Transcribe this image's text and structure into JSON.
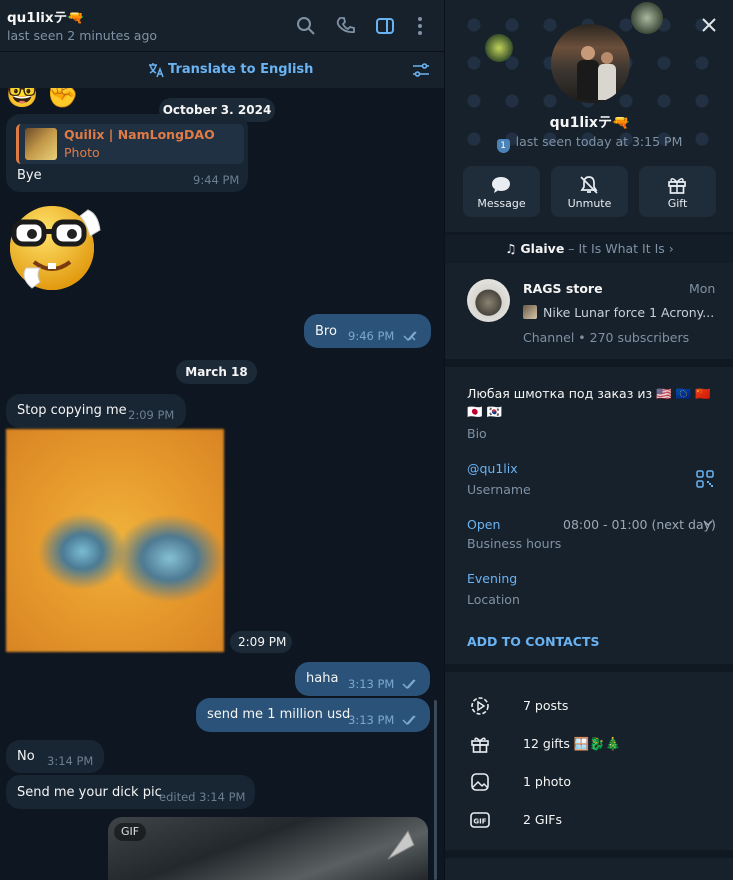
{
  "chat": {
    "header": {
      "title": "qu1lixテ🔫",
      "status": "last seen 2 minutes ago"
    },
    "translate_label": "Translate to English",
    "dates": [
      "October 3, 2024",
      "March 18"
    ],
    "reply": {
      "author": "Quilix | NamLongDAO",
      "kind": "Photo"
    },
    "messages": {
      "bye": {
        "text": "Bye",
        "time": "9:44 PM"
      },
      "bro": {
        "text": "Bro",
        "time": "9:46 PM"
      },
      "stop": {
        "text": "Stop copying me",
        "time": "2:09 PM"
      },
      "photo_time": "2:09 PM",
      "haha": {
        "text": "haha",
        "time": "3:13 PM"
      },
      "million": {
        "text": "send me 1 million usd",
        "time": "3:13 PM"
      },
      "no": {
        "text": "No",
        "time": "3:14 PM"
      },
      "dick": {
        "text": "Send me your dick pic",
        "time": "edited 3:14 PM"
      },
      "gif_label": "GIF"
    },
    "top_emojis": [
      "🤓",
      "✊"
    ]
  },
  "profile": {
    "name": "qu1lixテ🔫",
    "seen": "last seen today at 3:15 PM",
    "badge": "1",
    "actions": [
      "Message",
      "Unmute",
      "Gift"
    ],
    "music": {
      "artist": "Glaive",
      "track": " – It Is What It Is ›"
    },
    "channel": {
      "name": "RAGS store",
      "day": "Mon",
      "post": "Nike Lunar force 1 Acrony...",
      "meta": "Channel • 270 subscribers"
    },
    "bio": {
      "text": "Любая шмотка под заказ из 🇺🇸 🇪🇺 🇨🇳 🇯🇵 🇰🇷",
      "label": "Bio"
    },
    "username": {
      "value": "@qu1lix",
      "label": "Username"
    },
    "hours": {
      "status": "Open",
      "range": "08:00 - 01:00 (next day)",
      "label": "Business hours"
    },
    "location": {
      "value": "Evening",
      "label": "Location"
    },
    "add_contacts": "ADD TO CONTACTS",
    "media": [
      "7 posts",
      "12 gifts 🪟🐉🎄",
      "1 photo",
      "2 GIFs"
    ]
  },
  "colors": {
    "accent": "#6ab3f3",
    "outgoing": "#2b5278",
    "incoming": "#182533",
    "background": "#0e1621",
    "panel": "#17212b"
  }
}
